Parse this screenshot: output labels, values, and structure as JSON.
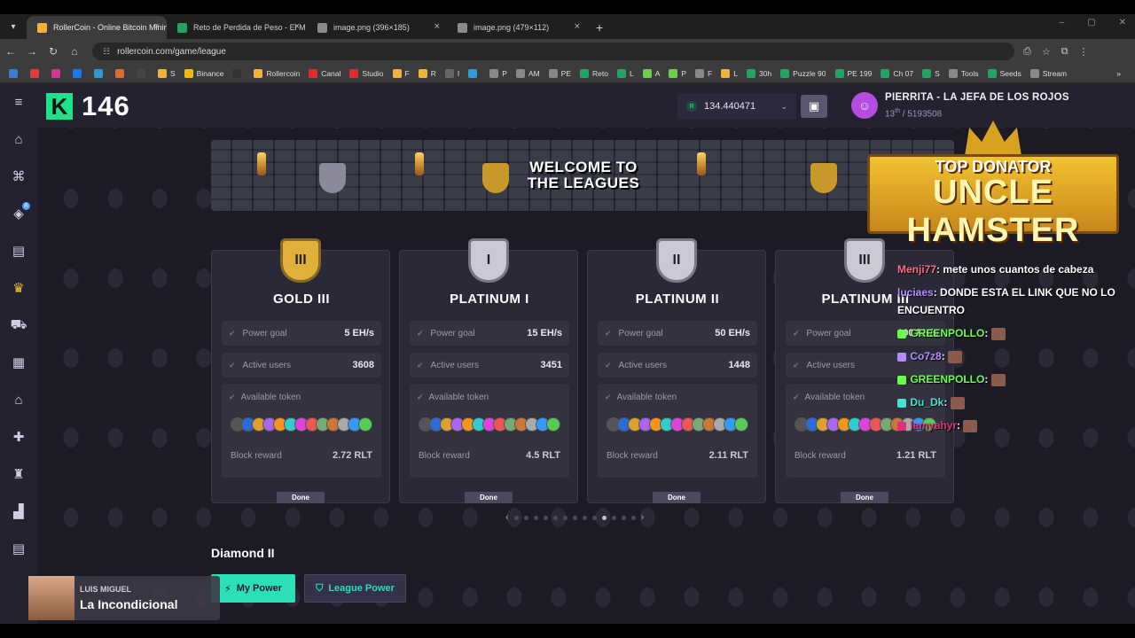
{
  "browser": {
    "tabs": [
      {
        "title": "RollerCoin - Online Bitcoin Mining",
        "color": "#f2b23a",
        "active": true
      },
      {
        "title": "Reto de Perdida de Peso - El M",
        "color": "#1fa463",
        "active": false
      },
      {
        "title": "image.png (396×185)",
        "color": "#8a8a8a",
        "active": false
      },
      {
        "title": "image.png (479×112)",
        "color": "#8a8a8a",
        "active": false
      }
    ],
    "url": "rollercoin.com/game/league",
    "bookmarks": [
      {
        "label": "",
        "color": "#3a7bd5"
      },
      {
        "label": "",
        "color": "#e03b3b"
      },
      {
        "label": "",
        "color": "#d6339a"
      },
      {
        "label": "",
        "color": "#1877f2"
      },
      {
        "label": "",
        "color": "#2b9bd1"
      },
      {
        "label": "",
        "color": "#e06a2b"
      },
      {
        "label": "",
        "color": "#444"
      },
      {
        "label": "S",
        "color": "#f2b23a"
      },
      {
        "label": "Binance",
        "color": "#f0b90b"
      },
      {
        "label": "",
        "color": "#333"
      },
      {
        "label": "Rollercoin",
        "color": "#f2b23a"
      },
      {
        "label": "Canal",
        "color": "#e02b2b"
      },
      {
        "label": "Studio",
        "color": "#e02b2b"
      },
      {
        "label": "F",
        "color": "#f2b23a"
      },
      {
        "label": "R",
        "color": "#f2b23a"
      },
      {
        "label": "I",
        "color": "#666"
      },
      {
        "label": "",
        "color": "#2a9fd6"
      },
      {
        "label": "P",
        "color": "#888"
      },
      {
        "label": "AM",
        "color": "#888"
      },
      {
        "label": "PE",
        "color": "#888"
      },
      {
        "label": "Reto",
        "color": "#1fa463"
      },
      {
        "label": "L",
        "color": "#1fa463"
      },
      {
        "label": "A",
        "color": "#6ad04a"
      },
      {
        "label": "P",
        "color": "#6ad04a"
      },
      {
        "label": "F",
        "color": "#888"
      },
      {
        "label": "L",
        "color": "#f2b23a"
      },
      {
        "label": "30h",
        "color": "#1fa463"
      },
      {
        "label": "Puzzle 90",
        "color": "#1fa463"
      },
      {
        "label": "PE 199",
        "color": "#1fa463"
      },
      {
        "label": "Ch 07",
        "color": "#1fa463"
      },
      {
        "label": "S",
        "color": "#1fa463"
      },
      {
        "label": "Tools",
        "color": "#888"
      },
      {
        "label": "Seeds",
        "color": "#1fa463"
      },
      {
        "label": "Stream",
        "color": "#888"
      }
    ]
  },
  "header": {
    "viewer_count": "146",
    "balance": "134.440471",
    "balance_currency": "R",
    "username": "PIERRITA - LA JEFA DE LOS ROJOS",
    "rank_position": "13",
    "rank_suffix": "th",
    "rank_total": "/ 5193508"
  },
  "sidebar": [
    "home-icon",
    "gamepad-icon",
    "rlt-icon",
    "store-icon",
    "crown-icon",
    "cart-icon",
    "inventory-icon",
    "marketplace-icon",
    "gift-icon",
    "trophy-icon",
    "factory-icon",
    "news-icon"
  ],
  "banner": {
    "title": "WELCOME TO THE LEAGUES"
  },
  "donator": {
    "line1": "TOP DONATOR",
    "line2": "UNCLE HAMSTER"
  },
  "leagues": [
    {
      "name": "GOLD III",
      "roman": "III",
      "color": "#e0b03a",
      "power_goal_label": "Power goal",
      "power_goal": "5 EH/s",
      "active_users_label": "Active users",
      "active_users": "3608",
      "token_label": "Available token",
      "block_reward_label": "Block reward",
      "block_reward": "2.72 RLT",
      "done": "Done"
    },
    {
      "name": "PLATINUM I",
      "roman": "I",
      "color": "#c9cad6",
      "power_goal_label": "Power goal",
      "power_goal": "15 EH/s",
      "active_users_label": "Active users",
      "active_users": "3451",
      "token_label": "Available token",
      "block_reward_label": "Block reward",
      "block_reward": "4.5 RLT",
      "done": "Done"
    },
    {
      "name": "PLATINUM II",
      "roman": "II",
      "color": "#c9cad6",
      "power_goal_label": "Power goal",
      "power_goal": "50 EH/s",
      "active_users_label": "Active users",
      "active_users": "1448",
      "token_label": "Available token",
      "block_reward_label": "Block reward",
      "block_reward": "2.11 RLT",
      "done": "Done"
    },
    {
      "name": "PLATINUM III",
      "roman": "III",
      "color": "#c9cad6",
      "power_goal_label": "Power goal",
      "power_goal": "100 EH/s",
      "active_users_label": "Active users",
      "active_users": "",
      "token_label": "Available token",
      "block_reward_label": "Block reward",
      "block_reward": "1.21 RLT",
      "done": "Done"
    }
  ],
  "pager": {
    "active_index": 9
  },
  "section": {
    "title": "Diamond II",
    "my_power": "My Power",
    "league_power": "League Power"
  },
  "chat": [
    {
      "user": "Menji77",
      "color": "#ff6b8a",
      "text": ": mete unos cuantos de cabeza"
    },
    {
      "user": "luciaes",
      "color": "#b48cff",
      "text": ": DONDE ESTA EL LINK QUE NO LO ENCUENTRO"
    },
    {
      "user": "GREENPOLLO",
      "color": "#6cff4a",
      "text": ":"
    },
    {
      "user": "Co7z8",
      "color": "#b48cff",
      "text": ":"
    },
    {
      "user": "GREENPOLLO",
      "color": "#6cff4a",
      "text": ":"
    },
    {
      "user": "Du_Dk",
      "color": "#4ae0d0",
      "text": ":"
    },
    {
      "user": "lamyahyr",
      "color": "#e0307a",
      "text": ":"
    }
  ],
  "music": {
    "artist": "LUIS MIGUEL",
    "song": "La Incondicional"
  }
}
